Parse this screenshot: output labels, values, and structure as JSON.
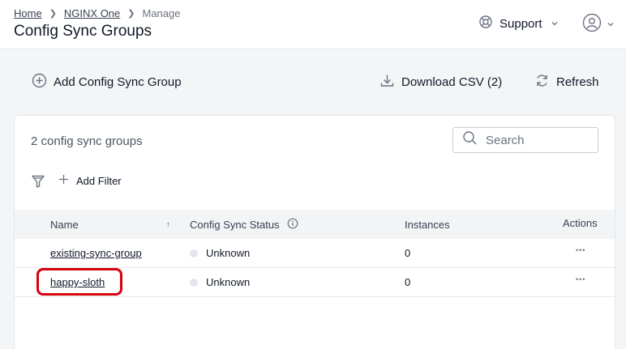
{
  "breadcrumb": {
    "home": "Home",
    "product": "NGINX One",
    "section": "Manage"
  },
  "page_title": "Config Sync Groups",
  "header": {
    "support_label": "Support"
  },
  "toolbar": {
    "add_label": "Add Config Sync Group",
    "download_label": "Download CSV (2)",
    "refresh_label": "Refresh"
  },
  "list": {
    "count_text": "2 config sync groups",
    "search_placeholder": "Search",
    "add_filter_label": "Add Filter",
    "columns": {
      "name": "Name",
      "sort_indicator": "↑",
      "status": "Config Sync Status",
      "instances": "Instances",
      "actions": "Actions"
    },
    "rows": [
      {
        "name": "existing-sync-group",
        "status": "Unknown",
        "instances": "0",
        "actions": "•••"
      },
      {
        "name": "happy-sloth",
        "status": "Unknown",
        "instances": "0",
        "actions": "•••"
      }
    ]
  },
  "colors": {
    "highlight": "#d6000f",
    "status_unknown": "#e2e4f0"
  }
}
